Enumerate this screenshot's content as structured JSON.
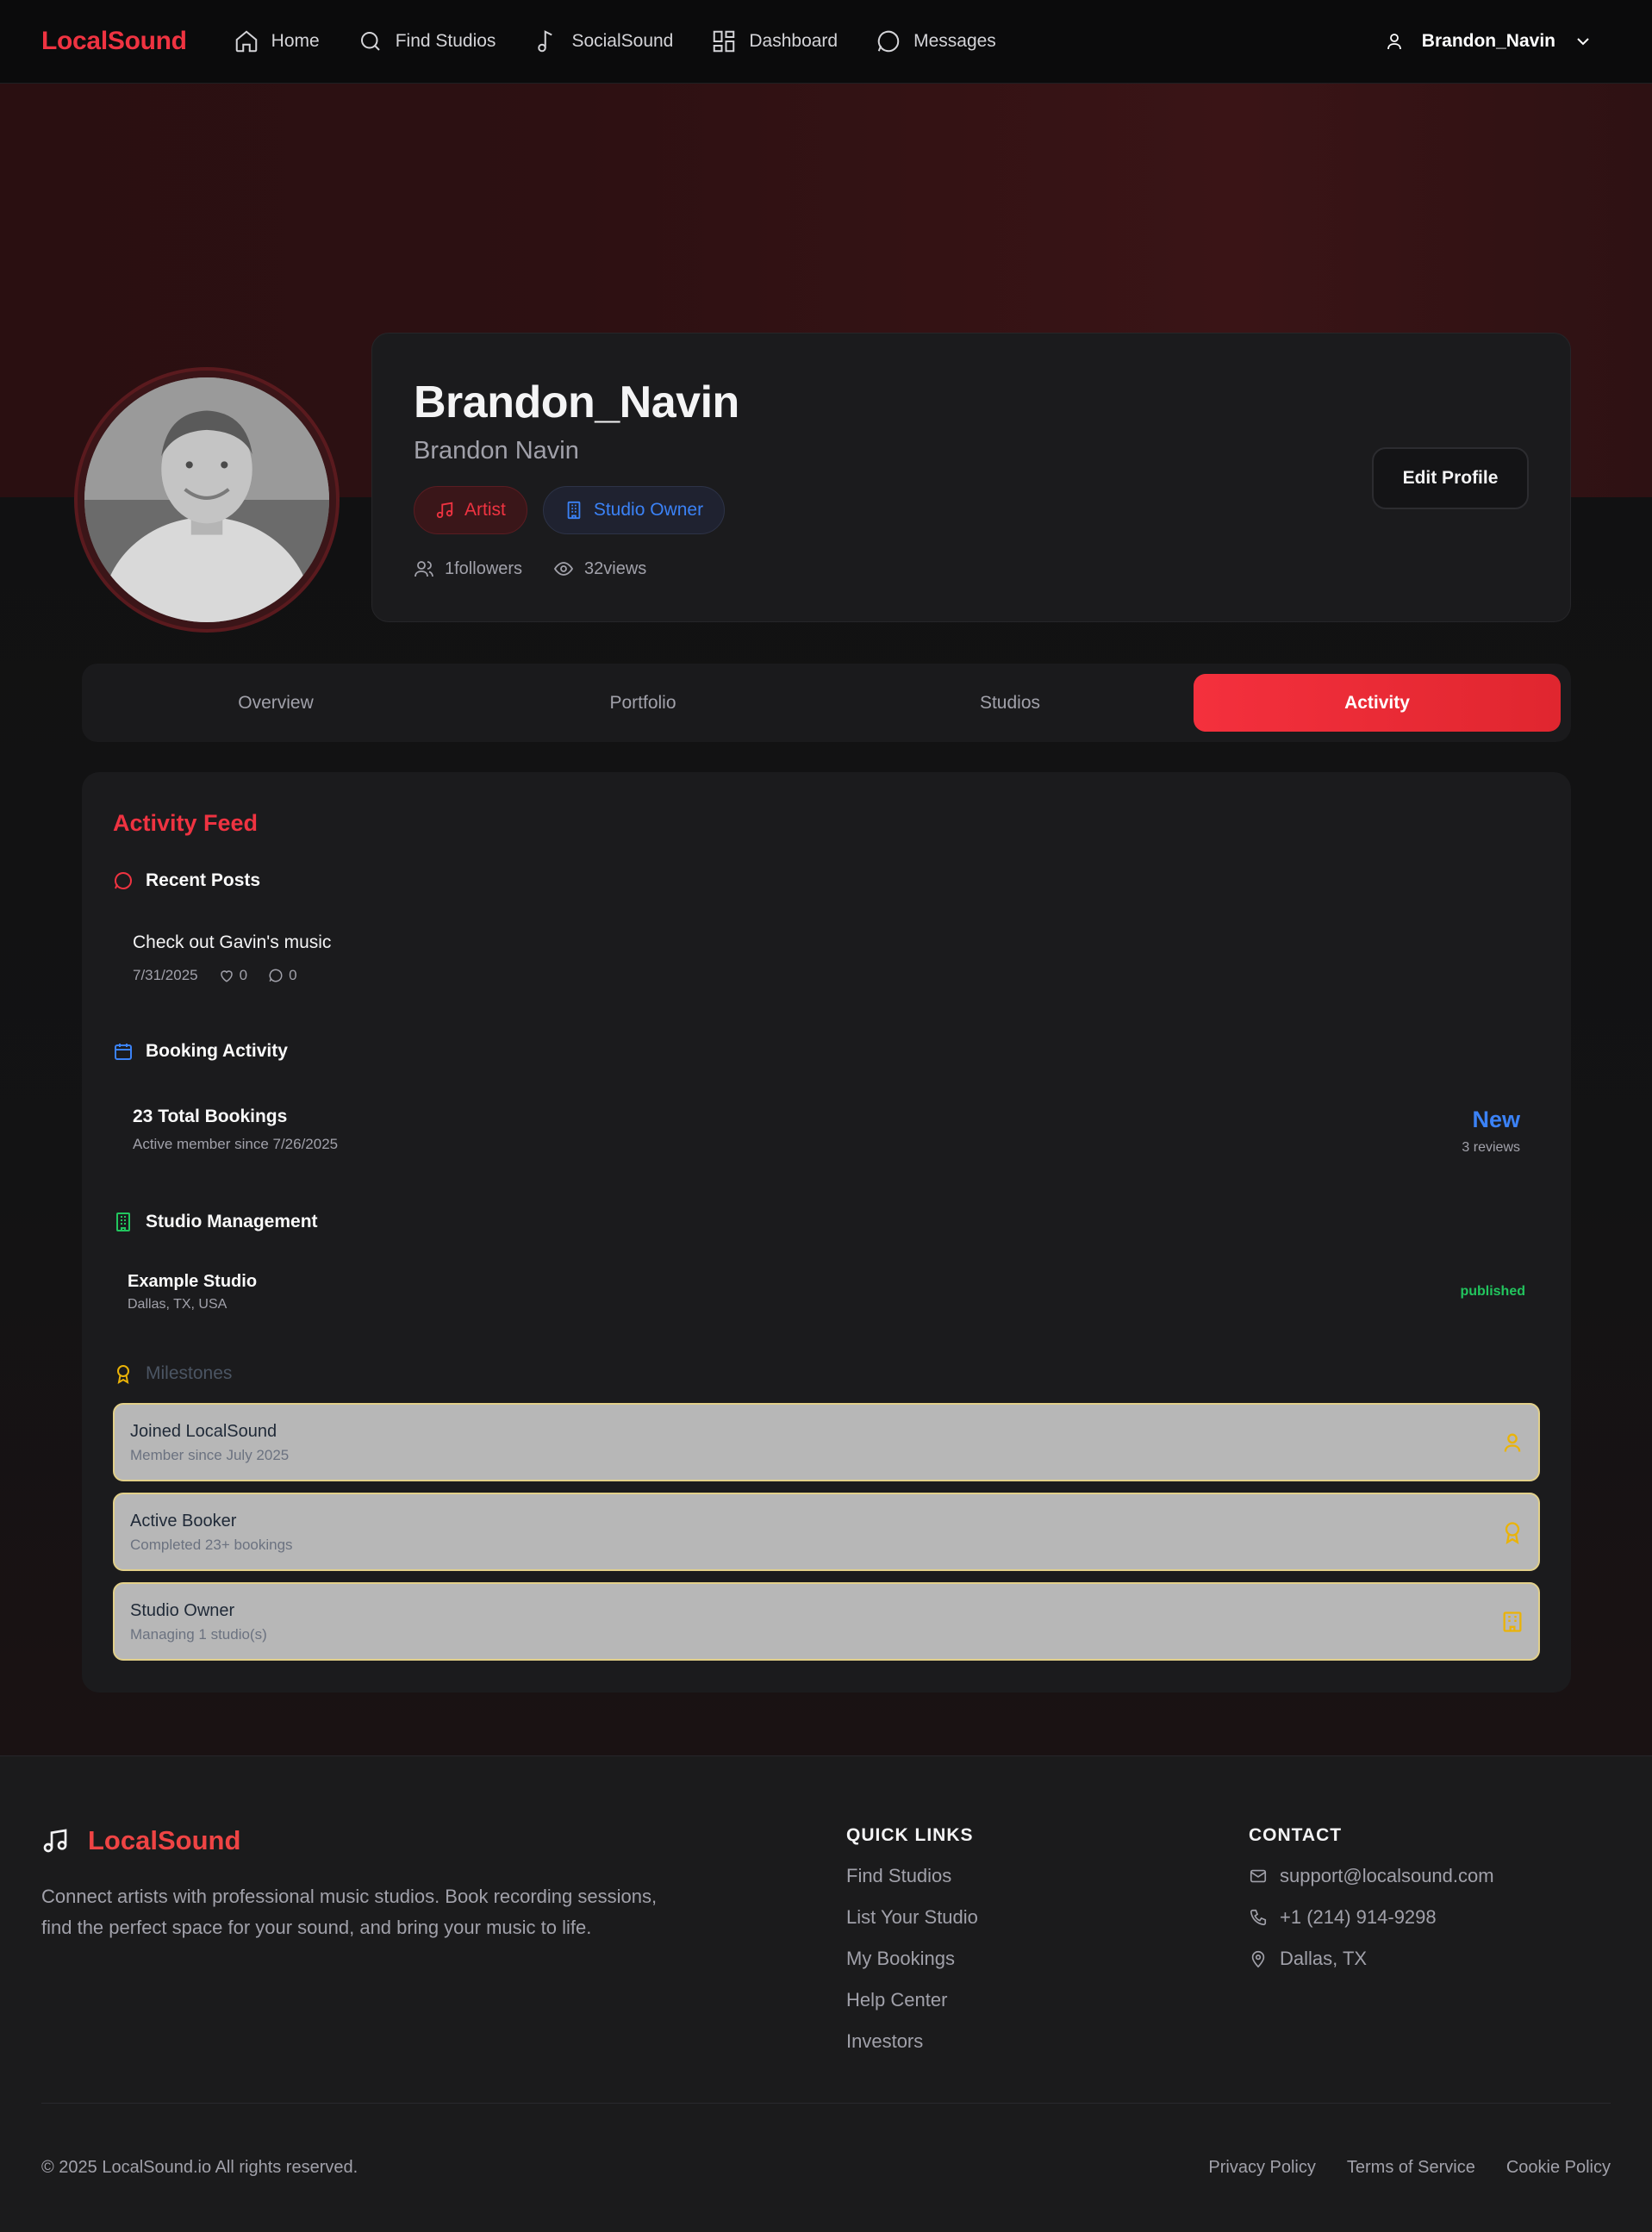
{
  "nav": {
    "brand": "LocalSound",
    "items": [
      {
        "label": "Home",
        "icon": "home-icon"
      },
      {
        "label": "Find Studios",
        "icon": "search-icon"
      },
      {
        "label": "SocialSound",
        "icon": "music-note-icon"
      },
      {
        "label": "Dashboard",
        "icon": "dashboard-icon"
      },
      {
        "label": "Messages",
        "icon": "message-icon"
      }
    ],
    "user": "Brandon_Navin"
  },
  "profile": {
    "handle": "Brandon_Navin",
    "name": "Brandon Navin",
    "badges": {
      "artist": "Artist",
      "owner": "Studio Owner"
    },
    "followers": "1followers",
    "views": "32views",
    "edit_label": "Edit Profile"
  },
  "tabs": [
    "Overview",
    "Portfolio",
    "Studios",
    "Activity"
  ],
  "activity": {
    "title": "Activity Feed",
    "recent_posts": {
      "heading": "Recent Posts",
      "post_title": "Check out Gavin's music",
      "date": "7/31/2025",
      "likes": "0",
      "comments": "0"
    },
    "booking": {
      "heading": "Booking Activity",
      "total": "23 Total Bookings",
      "since": "Active member since 7/26/2025",
      "rating": "New",
      "reviews": "3 reviews"
    },
    "studio": {
      "heading": "Studio Management",
      "name": "Example Studio",
      "location": "Dallas, TX, USA",
      "status": "published"
    },
    "milestones": {
      "heading": "Milestones",
      "items": [
        {
          "title": "Joined LocalSound",
          "sub": "Member since July 2025",
          "icon": "user-icon"
        },
        {
          "title": "Active Booker",
          "sub": "Completed 23+ bookings",
          "icon": "award-icon"
        },
        {
          "title": "Studio Owner",
          "sub": "Managing 1 studio(s)",
          "icon": "building-icon"
        }
      ]
    }
  },
  "footer": {
    "brand": "LocalSound",
    "description": "Connect artists with professional music studios. Book recording sessions, find the perfect space for your sound, and bring your music to life.",
    "quick_links_title": "QUICK LINKS",
    "quick_links": [
      "Find Studios",
      "List Your Studio",
      "My Bookings",
      "Help Center",
      "Investors"
    ],
    "contact_title": "CONTACT",
    "email": "support@localsound.com",
    "phone": "+1 (214) 914-9298",
    "location": "Dallas, TX",
    "copyright": "© 2025 LocalSound.io All rights reserved.",
    "legal": [
      "Privacy Policy",
      "Terms of Service",
      "Cookie Policy"
    ]
  },
  "colors": {
    "accent": "#ef3341",
    "blue": "#3b82f6",
    "green": "#22c55e",
    "gold": "#eab308"
  }
}
